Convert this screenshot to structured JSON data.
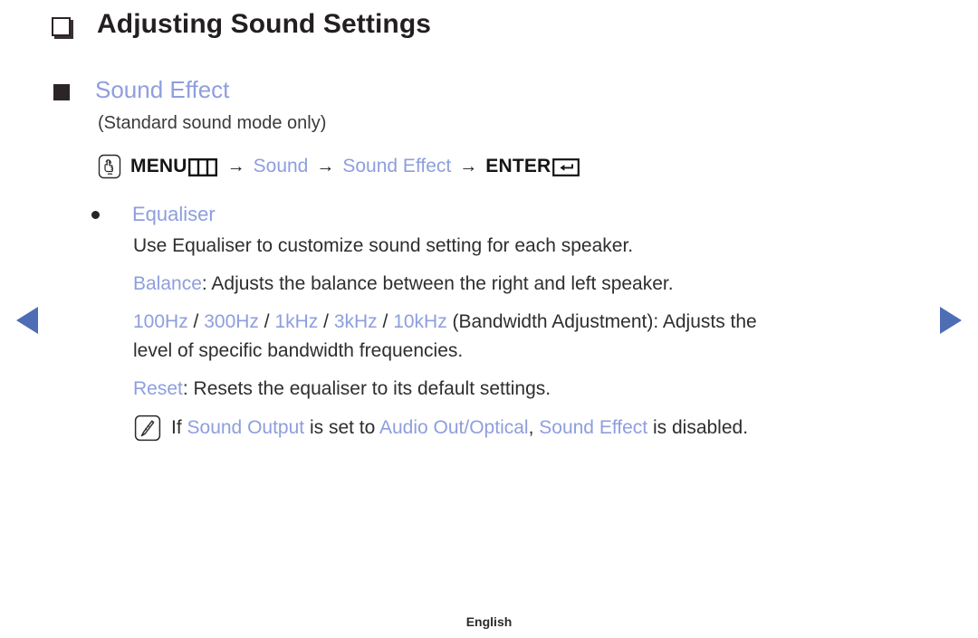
{
  "title": {
    "bullet_icon": "hollow-square-icon",
    "text": "Adjusting Sound Settings"
  },
  "section": {
    "bullet_icon": "filled-square-icon",
    "heading": "Sound Effect",
    "subnote": "(Standard sound mode only)"
  },
  "menu_path": {
    "hand_icon": "hand-press-icon",
    "menu_label": "MENU",
    "menu_icon": "menu-grid-icon",
    "arrow1": "→",
    "item1": "Sound",
    "arrow2": "→",
    "item2": "Sound Effect",
    "arrow3": "→",
    "enter_label": "ENTER",
    "enter_icon": "enter-return-icon"
  },
  "equaliser": {
    "bullet_icon": "round-bullet-icon",
    "label": "Equaliser",
    "description": "Use Equaliser to customize sound setting for each speaker.",
    "balance_term": "Balance",
    "balance_desc": ": Adjusts the balance between the right and left speaker.",
    "bands": [
      "100Hz",
      "300Hz",
      "1kHz",
      "3kHz",
      "10kHz"
    ],
    "band_sep": " / ",
    "band_desc": " (Bandwidth Adjustment): Adjusts the",
    "band_desc_line2": "level of specific bandwidth frequencies.",
    "reset_term": "Reset",
    "reset_desc": ": Resets the equaliser to its default settings."
  },
  "note": {
    "icon": "note-pencil-icon",
    "part1": "If ",
    "term1": "Sound Output",
    "part2": " is set to ",
    "term2": "Audio Out/Optical",
    "part3": ", ",
    "term3": "Sound Effect",
    "part4": " is disabled."
  },
  "nav": {
    "prev_icon": "prev-page-arrow-icon",
    "next_icon": "next-page-arrow-icon"
  },
  "footer": {
    "language": "English"
  },
  "colors": {
    "accent_blue": "#8e9ede",
    "nav_blue": "#4d6db5",
    "text_dark": "#2b2b2b"
  }
}
